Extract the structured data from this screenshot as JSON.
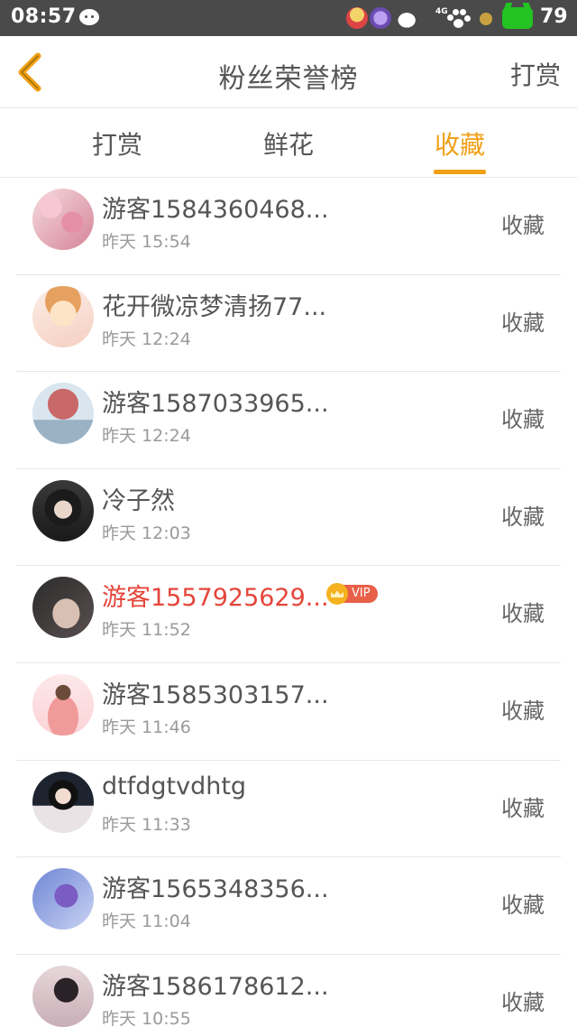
{
  "status_bar": {
    "time": "08:57",
    "network": "4G",
    "battery": "79",
    "icons": [
      "wechat-icon",
      "cartoon-app-icon",
      "cartoon-app-icon-2",
      "mouse-app-icon",
      "paw-icon",
      "small-app-icon",
      "battery-icon"
    ]
  },
  "header": {
    "title": "粉丝荣誉榜",
    "right_button": "打赏",
    "back_icon": "chevron-left-icon"
  },
  "tabs": [
    {
      "label": "打赏",
      "active": false
    },
    {
      "label": "鲜花",
      "active": false
    },
    {
      "label": "收藏",
      "active": true
    }
  ],
  "colors": {
    "accent": "#f0a016",
    "vip_name": "#e5453a",
    "divider": "#e6e6e6",
    "statusbar": "#4a4a4a"
  },
  "fans": [
    {
      "name": "游客1584360468...",
      "time": "昨天 15:54",
      "action": "收藏",
      "vip": false
    },
    {
      "name": "花开微凉梦清扬77...",
      "time": "昨天 12:24",
      "action": "收藏",
      "vip": false
    },
    {
      "name": "游客1587033965...",
      "time": "昨天 12:24",
      "action": "收藏",
      "vip": false
    },
    {
      "name": "冷子然",
      "time": "昨天 12:03",
      "action": "收藏",
      "vip": false
    },
    {
      "name": "游客1557925629...",
      "time": "昨天 11:52",
      "action": "收藏",
      "vip": true,
      "vip_label": "VIP"
    },
    {
      "name": "游客1585303157...",
      "time": "昨天 11:46",
      "action": "收藏",
      "vip": false
    },
    {
      "name": "dtfdgtvdhtg",
      "time": "昨天 11:33",
      "action": "收藏",
      "vip": false
    },
    {
      "name": "游客1565348356...",
      "time": "昨天 11:04",
      "action": "收藏",
      "vip": false
    },
    {
      "name": "游客1586178612...",
      "time": "昨天 10:55",
      "action": "收藏",
      "vip": false
    }
  ]
}
